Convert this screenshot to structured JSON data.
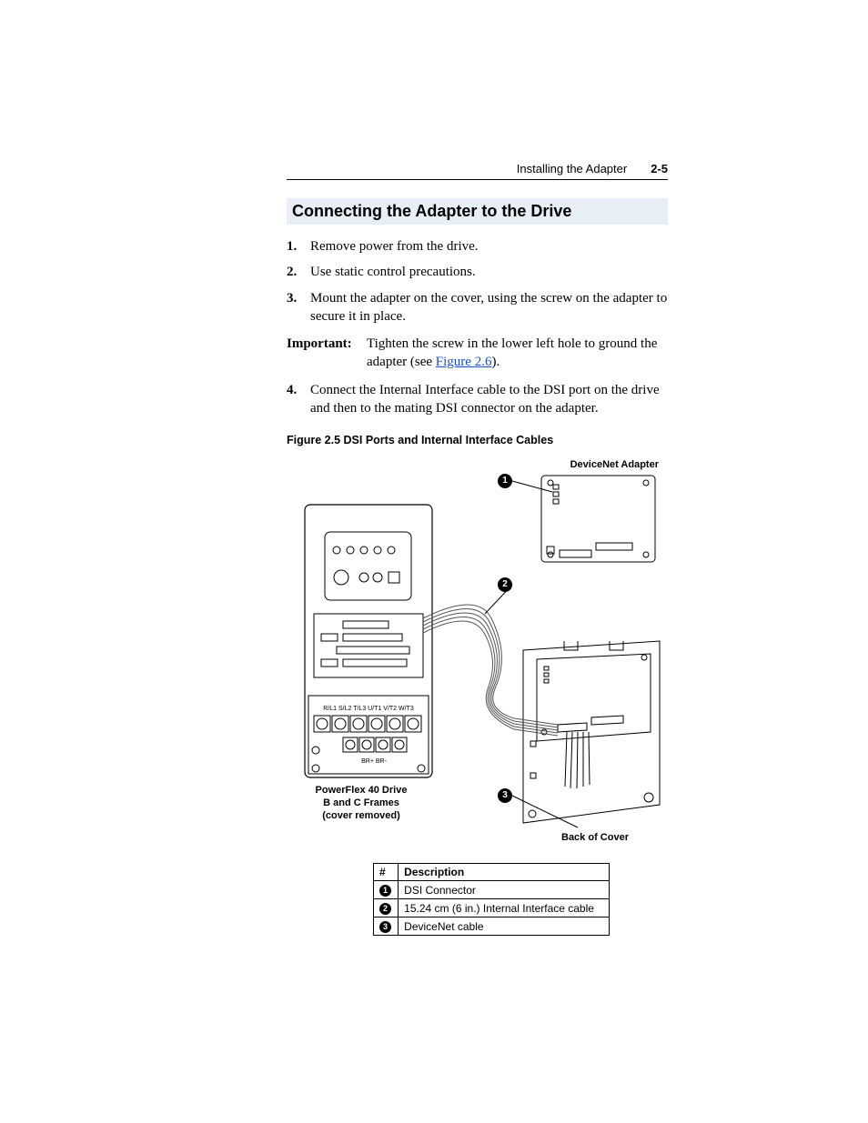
{
  "header": {
    "title": "Installing the Adapter",
    "page_number": "2-5"
  },
  "section_heading": "Connecting the Adapter to the Drive",
  "steps": [
    {
      "n": "1.",
      "text": "Remove power from the drive."
    },
    {
      "n": "2.",
      "text": "Use static control precautions."
    },
    {
      "n": "3.",
      "text": "Mount the adapter on the cover, using the screw on the adapter to secure it in place."
    }
  ],
  "important": {
    "label": "Important:",
    "text_before_link": "Tighten the screw in the lower left hole to ground the adapter (see ",
    "link_text": "Figure 2.6",
    "text_after_link": ")."
  },
  "step4": {
    "n": "4.",
    "text": "Connect the Internal Interface cable to the DSI port on the drive and then to the mating DSI connector on the adapter."
  },
  "figure": {
    "caption": "Figure 2.5   DSI Ports and Internal Interface Cables",
    "labels": {
      "adapter": "DeviceNet Adapter",
      "drive_line1": "PowerFlex 40 Drive",
      "drive_line2": "B and C Frames",
      "drive_line3": "(cover removed)",
      "back_cover": "Back of Cover"
    },
    "callouts": {
      "c1": "1",
      "c2": "2",
      "c3": "3"
    },
    "terminals": "R/L1 S/L2 T/L3 U/T1 V/T2 W/T3",
    "terminals2": "BR+ BR-"
  },
  "table": {
    "headers": {
      "col1": "#",
      "col2": "Description"
    },
    "rows": [
      {
        "num": "1",
        "desc": "DSI Connector"
      },
      {
        "num": "2",
        "desc": "15.24 cm (6 in.) Internal Interface cable"
      },
      {
        "num": "3",
        "desc": "DeviceNet cable"
      }
    ]
  }
}
